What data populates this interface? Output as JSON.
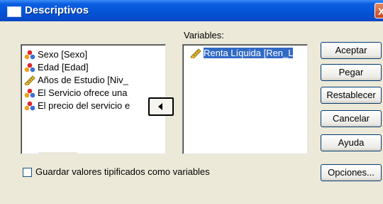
{
  "window": {
    "title": "Descriptivos",
    "close_label": "X"
  },
  "source_list": {
    "items": [
      {
        "label": "Sexo [Sexo]",
        "icon": "nominal-variable-icon"
      },
      {
        "label": "Edad [Edad]",
        "icon": "nominal-variable-icon"
      },
      {
        "label": "Años de Estudio [Niv_",
        "icon": "scale-variable-icon"
      },
      {
        "label": "El Servicio ofrece una",
        "icon": "nominal-variable-icon"
      },
      {
        "label": "El precio del servicio e",
        "icon": "nominal-variable-icon"
      }
    ]
  },
  "variables": {
    "label": "Variables:",
    "items": [
      {
        "label": "Renta Líquida [Ren_L",
        "icon": "scale-variable-icon",
        "selected": true
      }
    ]
  },
  "buttons": {
    "aceptar": "Aceptar",
    "pegar": "Pegar",
    "restablecer": "Restablecer",
    "cancelar": "Cancelar",
    "ayuda": "Ayuda",
    "opciones": "Opciones..."
  },
  "checkbox": {
    "label": "Guardar valores tipificados como variables",
    "checked": false
  },
  "colors": {
    "titlebar": "#0453d6",
    "dialog_bg": "#ece9d8",
    "selection": "#316ac5"
  }
}
